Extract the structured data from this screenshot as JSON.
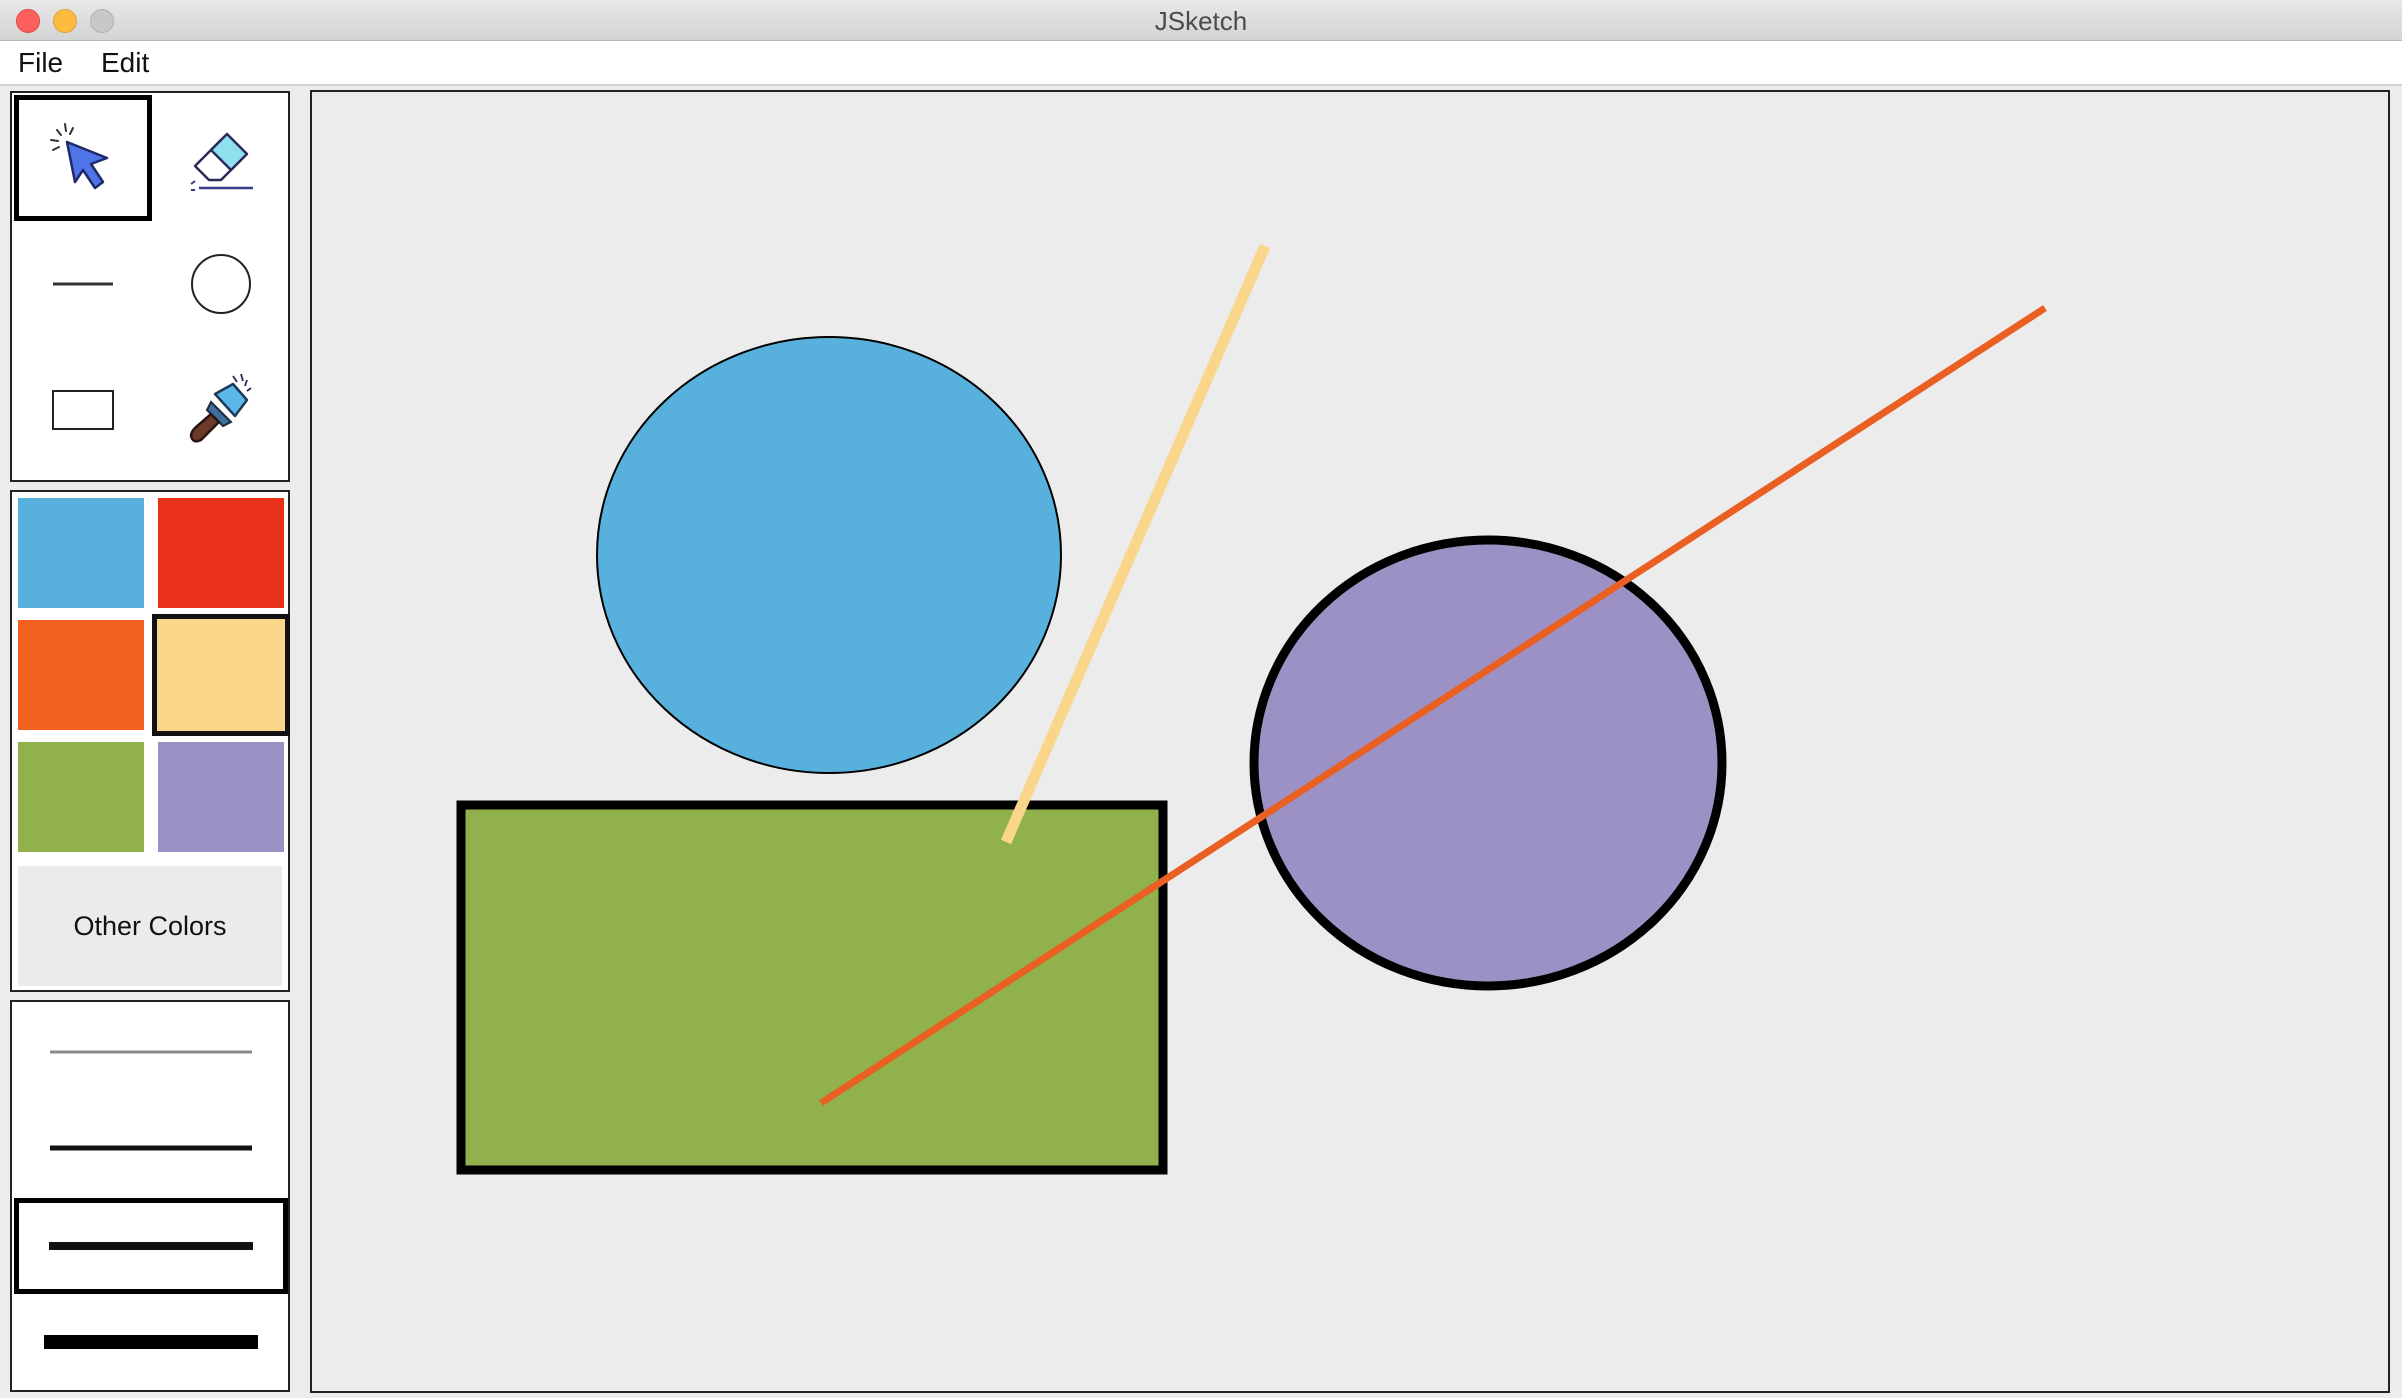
{
  "window": {
    "title": "JSketch"
  },
  "menu": {
    "file": "File",
    "edit": "Edit"
  },
  "tools": {
    "items": [
      "select",
      "erase",
      "line",
      "circle",
      "rectangle",
      "fill"
    ],
    "selected": "select"
  },
  "palette": {
    "swatches": [
      {
        "color": "#58b1dc",
        "selected": false
      },
      {
        "color": "#e83118",
        "selected": false
      },
      {
        "color": "#f26120",
        "selected": false
      },
      {
        "color": "#f9d68a",
        "selected": true
      },
      {
        "color": "#90b14c",
        "selected": false
      },
      {
        "color": "#9b91c4",
        "selected": false
      }
    ],
    "other_colors_label": "Other Colors"
  },
  "line_widths": {
    "options": [
      1,
      2,
      3,
      4
    ],
    "selected": 3
  },
  "canvas": {
    "shapes": [
      {
        "type": "ellipse",
        "fill": "#58b1dc",
        "stroke": "#000000",
        "stroke_width": 1
      },
      {
        "type": "rectangle",
        "fill": "#90b14c",
        "stroke": "#000000",
        "stroke_width": 4
      },
      {
        "type": "line",
        "stroke": "#f9d68a",
        "stroke_width": 3
      },
      {
        "type": "ellipse",
        "fill": "#9b91c4",
        "stroke": "#000000",
        "stroke_width": 4
      },
      {
        "type": "line",
        "stroke": "#ea5f22",
        "stroke_width": 2
      }
    ]
  }
}
